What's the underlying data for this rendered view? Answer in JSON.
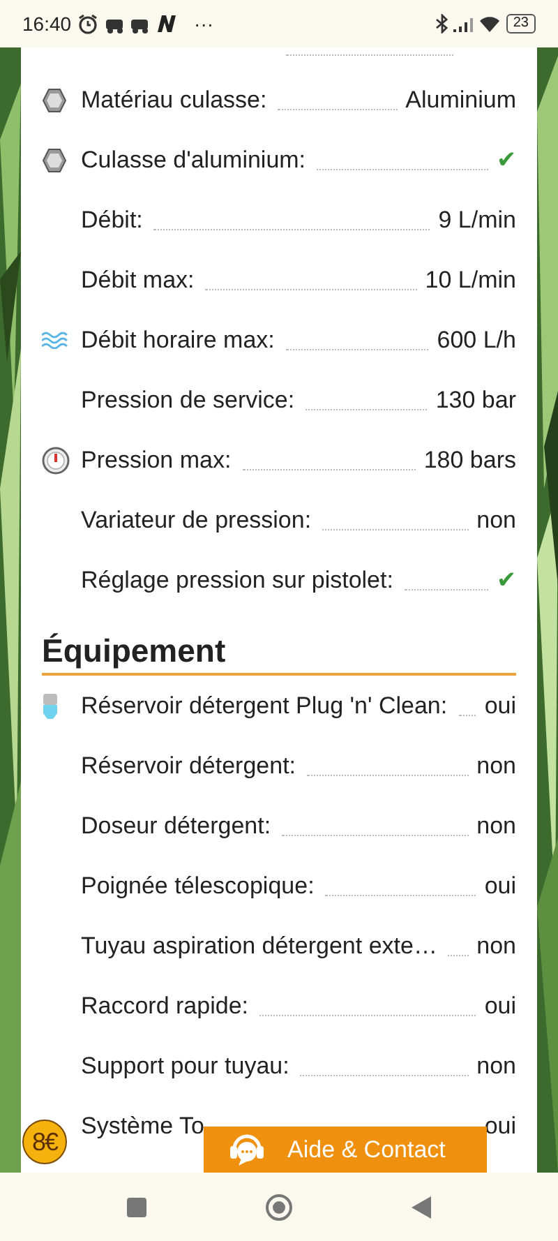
{
  "status_bar": {
    "time": "16:40",
    "more": "···",
    "battery": "23"
  },
  "sections": [
    {
      "rows": [
        {
          "label": "Matériau culasse:",
          "value": "Aluminium",
          "kind": "alu_text"
        },
        {
          "label": "Culasse d'aluminium:",
          "value": "✔",
          "kind": "alu_check"
        },
        {
          "label": "Débit:",
          "value": "9 L/min",
          "kind": "plain_text"
        },
        {
          "label": "Débit max:",
          "value": "10 L/min",
          "kind": "plain_text"
        },
        {
          "label": "Débit horaire max:",
          "value": "600 L/h",
          "kind": "waves_text"
        },
        {
          "label": "Pression de service:",
          "value": "130 bar",
          "kind": "plain_text"
        },
        {
          "label": "Pression max:",
          "value": "180 bars",
          "kind": "gauge_text"
        },
        {
          "label": "Variateur de pression:",
          "value": "non",
          "kind": "plain_text"
        },
        {
          "label": "Réglage pression sur pistolet:",
          "value": "✔",
          "kind": "plain_check"
        }
      ]
    },
    {
      "heading": "Équipement",
      "rows": [
        {
          "label": "Réservoir détergent Plug 'n' Clean:",
          "value": "oui",
          "kind": "bottle_text"
        },
        {
          "label": "Réservoir détergent:",
          "value": "non",
          "kind": "plain_text"
        },
        {
          "label": "Doseur détergent:",
          "value": "non",
          "kind": "plain_text"
        },
        {
          "label": "Poignée télescopique:",
          "value": "oui",
          "kind": "plain_text"
        },
        {
          "label": "Tuyau aspiration détergent exte…",
          "value": "non",
          "kind": "plain_text"
        },
        {
          "label": "Raccord rapide:",
          "value": "oui",
          "kind": "plain_text"
        },
        {
          "label": "Support pour tuyau:",
          "value": "non",
          "kind": "plain_text"
        },
        {
          "label": "Système To",
          "value": "oui",
          "kind": "plain_text"
        }
      ]
    }
  ],
  "price_badge": "8€",
  "help_button": {
    "label": "Aide & Contact"
  }
}
